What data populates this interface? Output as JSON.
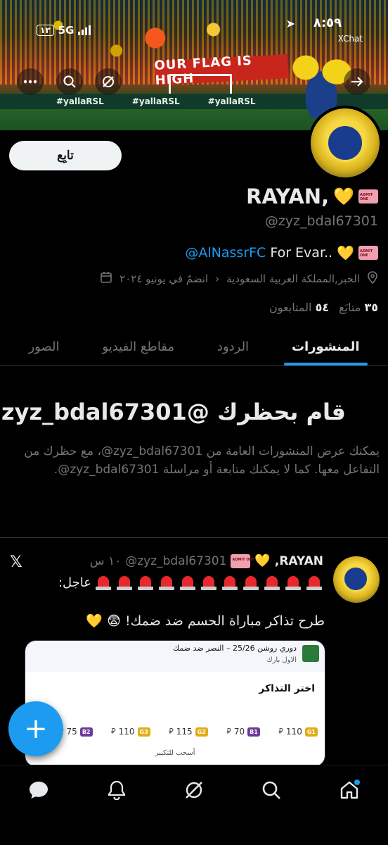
{
  "status_bar": {
    "time": "٨:٥٩",
    "carrier": "XChat",
    "network": "5G",
    "battery": "١٣"
  },
  "banner": {
    "flag_text": "OUR FLAG IS HIGH",
    "ad_text": [
      "#yallaRSL",
      "#yallaRSL",
      "#yallaRSL"
    ]
  },
  "profile": {
    "follow_label": "تابِع",
    "name": "RAYAN,",
    "handle": "@zyz_bdal67301",
    "bio_mention": "@AlNassrFC",
    "bio_text": "For Evar..",
    "location": "الخبر,المملكة العربية السعودية",
    "joined": "انضمّ في يونيو ٢٠٢٤",
    "following_count": "٣٥",
    "following_label": "متابَع",
    "followers_count": "٥٤",
    "followers_label": "المتابعون"
  },
  "tabs": [
    {
      "label": "المنشورات",
      "active": true
    },
    {
      "label": "الردود",
      "active": false
    },
    {
      "label": "مقاطع الفيديو",
      "active": false
    },
    {
      "label": "الصور",
      "active": false
    }
  ],
  "blocked": {
    "title": "قام بحظرك @zyz_bdal67301",
    "text": "يمكنك عرض المنشورات العامة من ‎@zyz_bdal67301، مع حظرك من التفاعل معها. كما لا يمكنك متابعة أو مراسلة ‎@zyz_bdal67301."
  },
  "post": {
    "name": "RAYAN,",
    "handle": "@zyz_bdal67301",
    "time": "١٠ س",
    "line1": "عاجل:",
    "line2": "طرح تذاكر مباراة الحسم ضد ضمك! 😨 💛",
    "embed": {
      "header_title": "دوري روشن 25/26 – النصر ضد ضمك",
      "header_sub": "الاول بارك",
      "pick_title": "اختر التذاكر",
      "drag_hint": "أسحب للتكبير",
      "prices": [
        {
          "value": "75",
          "tag": "B2",
          "kind": "b"
        },
        {
          "value": "110",
          "tag": "G3",
          "kind": "g"
        },
        {
          "value": "115",
          "tag": "G2",
          "kind": "g"
        },
        {
          "value": "70",
          "tag": "B1",
          "kind": "b"
        },
        {
          "value": "110",
          "tag": "G1",
          "kind": "g"
        }
      ]
    }
  },
  "fab_label": "+",
  "icons": {
    "back": "arrow-right-icon",
    "search": "search-icon",
    "grok": "grok-icon",
    "more": "more-icon"
  }
}
